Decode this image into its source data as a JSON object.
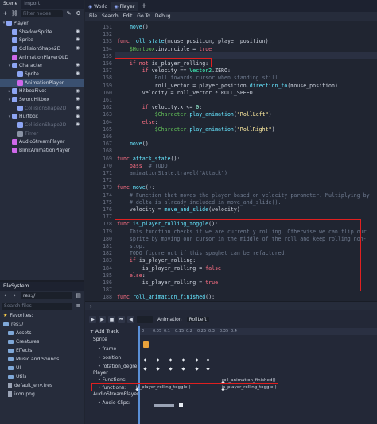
{
  "left_dock": {
    "tabs": [
      "Scene",
      "Import"
    ],
    "filter_placeholder": "Filter nodes",
    "tree": [
      {
        "label": "Player",
        "depth": 0,
        "icon": "kinematic-body-icon",
        "color": "#8da5f3",
        "eye": false,
        "arrow": "▾"
      },
      {
        "label": "ShadowSprite",
        "depth": 1,
        "icon": "sprite-icon",
        "color": "#8da5f3",
        "eye": true
      },
      {
        "label": "Sprite",
        "depth": 1,
        "icon": "sprite-icon",
        "color": "#8da5f3",
        "eye": true
      },
      {
        "label": "CollisionShape2D",
        "depth": 1,
        "icon": "collision-shape-icon",
        "color": "#8da5f3",
        "eye": true
      },
      {
        "label": "AnimationPlayerOLD",
        "depth": 1,
        "icon": "animation-player-icon",
        "color": "#cf68ea",
        "eye": false
      },
      {
        "label": "Character",
        "depth": 1,
        "icon": "node2d-icon",
        "color": "#8da5f3",
        "eye": true,
        "arrow": "▾"
      },
      {
        "label": "Sprite",
        "depth": 2,
        "icon": "sprite-icon",
        "color": "#8da5f3",
        "eye": true
      },
      {
        "label": "AnimationPlayer",
        "depth": 2,
        "icon": "animation-player-icon",
        "color": "#cf68ea",
        "eye": false,
        "selected": true
      },
      {
        "label": "HitboxPivot",
        "depth": 1,
        "icon": "position2d-icon",
        "color": "#8da5f3",
        "eye": true,
        "arrow": "▸"
      },
      {
        "label": "SwordHitbox",
        "depth": 1,
        "icon": "area2d-icon",
        "color": "#8da5f3",
        "eye": true,
        "arrow": "▾"
      },
      {
        "label": "CollisionShape2D",
        "depth": 2,
        "icon": "collision-shape-icon",
        "color": "#8da5f3",
        "eye": true,
        "dim": true
      },
      {
        "label": "Hurtbox",
        "depth": 1,
        "icon": "area2d-icon",
        "color": "#8da5f3",
        "eye": true,
        "arrow": "▾"
      },
      {
        "label": "CollisionShape2D",
        "depth": 2,
        "icon": "collision-shape-icon",
        "color": "#8da5f3",
        "eye": true,
        "dim": true
      },
      {
        "label": "Timer",
        "depth": 2,
        "icon": "timer-icon",
        "color": "#8a93a5",
        "eye": false,
        "dim": true
      },
      {
        "label": "AudioStreamPlayer",
        "depth": 1,
        "icon": "audio-icon",
        "color": "#cf68ea",
        "eye": false
      },
      {
        "label": "BlinkAnimationPlayer",
        "depth": 1,
        "icon": "animation-player-icon",
        "color": "#cf68ea",
        "eye": false
      }
    ],
    "filesystem": {
      "title": "FileSystem",
      "path": "res://",
      "search_placeholder": "Search files",
      "favorites": "Favorites:",
      "items": [
        {
          "label": "res://",
          "type": "folder",
          "depth": 0
        },
        {
          "label": "Assets",
          "type": "folder",
          "depth": 1
        },
        {
          "label": "Creatures",
          "type": "folder",
          "depth": 1
        },
        {
          "label": "Effects",
          "type": "folder",
          "depth": 1
        },
        {
          "label": "Music and Sounds",
          "type": "folder",
          "depth": 1
        },
        {
          "label": "UI",
          "type": "folder",
          "depth": 1
        },
        {
          "label": "Utils",
          "type": "folder",
          "depth": 1
        },
        {
          "label": "default_env.tres",
          "type": "file",
          "depth": 1
        },
        {
          "label": "icon.png",
          "type": "file",
          "depth": 1
        }
      ]
    }
  },
  "editor": {
    "tabs": [
      "World",
      "Player",
      "+"
    ],
    "menu": [
      "File",
      "Search",
      "Edit",
      "Go To",
      "Debug"
    ],
    "lines": [
      {
        "n": "151",
        "t": [
          [
            "    ",
            ""
          ],
          [
            "move",
            "fn"
          ],
          [
            "()",
            ""
          ]
        ]
      },
      {
        "n": "152",
        "t": []
      },
      {
        "n": "153",
        "t": [
          [
            "func ",
            "kw"
          ],
          [
            "roll_state",
            "fn"
          ],
          [
            "(mouse_position, player_position):",
            ""
          ]
        ]
      },
      {
        "n": "154",
        "t": [
          [
            "    ",
            ""
          ],
          [
            "$Hurtbox",
            "nd"
          ],
          [
            ".invincible = ",
            ""
          ],
          [
            "true",
            "kw"
          ]
        ]
      },
      {
        "n": "155",
        "t": []
      },
      {
        "n": "156",
        "t": [
          [
            "    ",
            ""
          ],
          [
            "if not ",
            "kw"
          ],
          [
            "is_player_rolling:",
            ""
          ]
        ]
      },
      {
        "n": "157",
        "t": [
          [
            "        ",
            ""
          ],
          [
            "if ",
            "kw"
          ],
          [
            "velocity == ",
            ""
          ],
          [
            "Vector2",
            "ty"
          ],
          [
            ".ZERO:",
            ""
          ]
        ]
      },
      {
        "n": "158",
        "t": [
          [
            "            ",
            ""
          ],
          [
            "Roll towards cursor when standing still",
            "com"
          ]
        ]
      },
      {
        "n": "159",
        "t": [
          [
            "            roll_vector = player_position.",
            ""
          ],
          [
            "direction_to",
            "fn"
          ],
          [
            "(mouse_position)",
            ""
          ]
        ]
      },
      {
        "n": "160",
        "t": [
          [
            "        velocity = roll_vector * ROLL_SPEED",
            ""
          ]
        ]
      },
      {
        "n": "161",
        "t": []
      },
      {
        "n": "162",
        "t": [
          [
            "        ",
            ""
          ],
          [
            "if ",
            "kw"
          ],
          [
            "velocity.x <= ",
            ""
          ],
          [
            "0",
            "num"
          ],
          [
            ":",
            ""
          ]
        ]
      },
      {
        "n": "163",
        "t": [
          [
            "            ",
            ""
          ],
          [
            "$Character",
            "nd"
          ],
          [
            ".",
            ""
          ],
          [
            "play_animation",
            "fn"
          ],
          [
            "(",
            ""
          ],
          [
            "\"RollLeft\"",
            "str"
          ],
          [
            ")",
            ""
          ]
        ]
      },
      {
        "n": "164",
        "t": [
          [
            "        ",
            ""
          ],
          [
            "else",
            "kw"
          ],
          [
            ":",
            ""
          ]
        ]
      },
      {
        "n": "165",
        "t": [
          [
            "            ",
            ""
          ],
          [
            "$Character",
            "nd"
          ],
          [
            ".",
            ""
          ],
          [
            "play_animation",
            "fn"
          ],
          [
            "(",
            ""
          ],
          [
            "\"RollRight\"",
            "str"
          ],
          [
            ")",
            ""
          ]
        ]
      },
      {
        "n": "166",
        "t": []
      },
      {
        "n": "167",
        "t": [
          [
            "    ",
            ""
          ],
          [
            "move",
            "fn"
          ],
          [
            "()",
            ""
          ]
        ]
      },
      {
        "n": "168",
        "t": []
      },
      {
        "n": "169",
        "t": [
          [
            "func ",
            "kw"
          ],
          [
            "attack_state",
            "fn"
          ],
          [
            "():",
            ""
          ]
        ]
      },
      {
        "n": "170",
        "t": [
          [
            "    ",
            ""
          ],
          [
            "pass ",
            "kw"
          ],
          [
            " # TODO",
            "com"
          ]
        ]
      },
      {
        "n": "171",
        "t": [
          [
            "    animationState.travel(\"Attack\")",
            "com"
          ]
        ]
      },
      {
        "n": "172",
        "t": []
      },
      {
        "n": "173",
        "t": [
          [
            "func ",
            "kw"
          ],
          [
            "move",
            "fn"
          ],
          [
            "():",
            ""
          ]
        ]
      },
      {
        "n": "174",
        "t": [
          [
            "    # Function that moves the player based on velocity parameter. Multiplying by",
            "com"
          ]
        ]
      },
      {
        "n": "175",
        "t": [
          [
            "    # delta is already included in move_and_slide().",
            "com"
          ]
        ]
      },
      {
        "n": "176",
        "t": [
          [
            "    velocity = ",
            ""
          ],
          [
            "move_and_slide",
            "fn"
          ],
          [
            "(velocity)",
            ""
          ]
        ]
      },
      {
        "n": "177",
        "t": []
      },
      {
        "n": "178",
        "t": [
          [
            "func ",
            "kw"
          ],
          [
            "is_player_rolling_toggle",
            "fn"
          ],
          [
            "():",
            ""
          ]
        ]
      },
      {
        "n": "179",
        "t": [
          [
            "    This function checks if we are currently rolling. Otherwise we can flip our",
            "com"
          ]
        ]
      },
      {
        "n": "180",
        "t": [
          [
            "    sprite by moving our cursor in the middle of the roll and keep rolling non-",
            "com"
          ]
        ]
      },
      {
        "n": "181",
        "t": [
          [
            "    stop.",
            "com"
          ]
        ]
      },
      {
        "n": "182",
        "t": [
          [
            "    TODO figure out if this spaghet can be refactored.",
            "com"
          ]
        ]
      },
      {
        "n": "183",
        "t": [
          [
            "    ",
            ""
          ],
          [
            "if ",
            "kw"
          ],
          [
            "is_player_rolling:",
            ""
          ]
        ]
      },
      {
        "n": "184",
        "t": [
          [
            "        is_player_rolling = ",
            ""
          ],
          [
            "false",
            "kw"
          ]
        ]
      },
      {
        "n": "185",
        "t": [
          [
            "    ",
            ""
          ],
          [
            "else",
            "kw"
          ],
          [
            ":",
            ""
          ]
        ]
      },
      {
        "n": "186",
        "t": [
          [
            "        is_player_rolling = ",
            ""
          ],
          [
            "true",
            "kw"
          ]
        ]
      },
      {
        "n": "187",
        "t": []
      },
      {
        "n": "188",
        "t": [
          [
            "func ",
            "kw"
          ],
          [
            "roll_animation_finished",
            "fn"
          ],
          [
            "():",
            ""
          ]
        ]
      }
    ],
    "expand_arrow": "›"
  },
  "animation": {
    "toolbar": [
      "▶",
      "▶",
      "■",
      "⏮",
      "◀"
    ],
    "label": "Animation",
    "anim_name": "RollLeft",
    "add_track": "+ Add Track",
    "ruler": [
      "0",
      "0.05",
      "0.1",
      "0.15",
      "0.2",
      "0.25",
      "0.3",
      "0.35",
      "0.4"
    ],
    "tracks": [
      {
        "label": "Sprite",
        "group": true
      },
      {
        "label": "• frame",
        "group": false
      },
      {
        "label": "• position:",
        "group": false
      },
      {
        "label": "• rotation_degre",
        "group": false
      },
      {
        "label": "Player",
        "group": true
      },
      {
        "label": "• Functions:",
        "group": false
      },
      {
        "label": "• functions:",
        "group": false
      },
      {
        "label": "AudioStreamPlayer",
        "group": true
      },
      {
        "label": "• Audio Clips:",
        "group": false
      }
    ],
    "call_labels": {
      "functions_row": "roll_animation_finished()",
      "toggle_a": "is_player_rolling_toggle()",
      "toggle_b": "is_player_rolling_toggle()"
    }
  }
}
